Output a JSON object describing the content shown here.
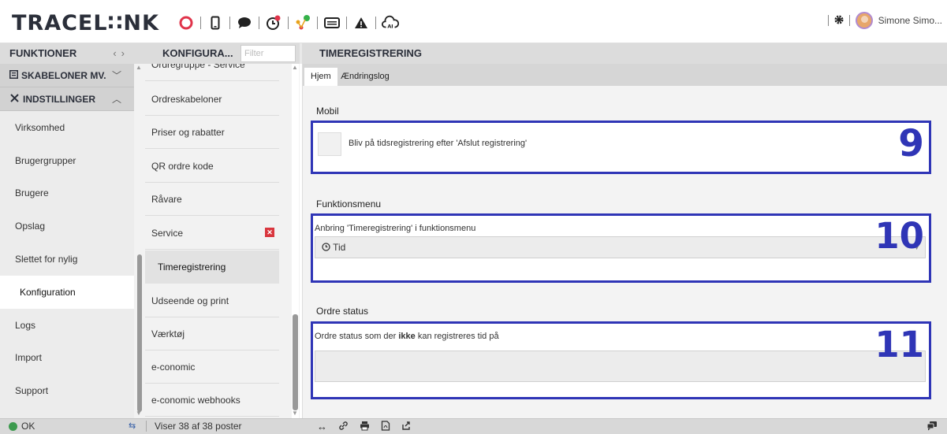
{
  "app": {
    "logo": "TRACEL∷NK",
    "user_name": "Simone Simo..."
  },
  "toolbar_icons": [
    "lifebuoy-icon",
    "phone-icon",
    "chat-icon",
    "clock-icon",
    "network-icon",
    "keyboard-icon",
    "warning-icon",
    "cloud-ai-icon"
  ],
  "headers": {
    "funktioner": "FUNKTIONER",
    "konfiguration": "KONFIGURA...",
    "filter_placeholder": "Filter",
    "timeregistrering": "TIMEREGISTRERING"
  },
  "sidebar": {
    "section_templates": "SKABELONER MV.",
    "section_settings": "INDSTILLINGER",
    "items": [
      {
        "label": "Virksomhed"
      },
      {
        "label": "Brugergrupper"
      },
      {
        "label": "Brugere"
      },
      {
        "label": "Opslag"
      },
      {
        "label": "Slettet for nylig"
      },
      {
        "label": "Konfiguration",
        "active": true
      },
      {
        "label": "Logs"
      },
      {
        "label": "Import"
      },
      {
        "label": "Support"
      }
    ]
  },
  "middle_list": {
    "items": [
      {
        "label": "Ordregruppe - Service"
      },
      {
        "label": "Ordreskabeloner"
      },
      {
        "label": "Priser og rabatter"
      },
      {
        "label": "QR ordre kode"
      },
      {
        "label": "Råvare"
      },
      {
        "label": "Service",
        "has_remove": true
      },
      {
        "label": "Timeregistrering",
        "active": true
      },
      {
        "label": "Udseende og print"
      },
      {
        "label": "Værktøj"
      },
      {
        "label": "e-conomic"
      },
      {
        "label": "e-conomic webhooks"
      }
    ]
  },
  "main": {
    "tabs": [
      {
        "label": "Hjem",
        "active": true
      },
      {
        "label": "Ændringslog"
      }
    ],
    "sections": {
      "mobil": {
        "title": "Mobil",
        "checkbox_label": "Bliv på tidsregistrering efter 'Afslut registrering'",
        "checked": false,
        "annotation": "9"
      },
      "funktionsmenu": {
        "title": "Funktionsmenu",
        "field_label": "Anbring 'Timeregistrering' i funktionsmenu",
        "selected_value": "Tid",
        "annotation": "10"
      },
      "ordre_status": {
        "title": "Ordre status",
        "field_label_pre": "Ordre status som der ",
        "field_label_bold": "ikke",
        "field_label_post": " kan registreres tid på",
        "value": "",
        "annotation": "11"
      }
    }
  },
  "statusbar": {
    "status": "OK",
    "record_count": "Viser 38 af 38 poster",
    "tool_icons": [
      "resize-icon",
      "link-icon",
      "print-icon",
      "pdf-icon",
      "share-icon"
    ]
  },
  "colors": {
    "annotation_blue": "#2f35b6",
    "remove_red": "#d9363e",
    "status_green": "#3c9a4e"
  }
}
